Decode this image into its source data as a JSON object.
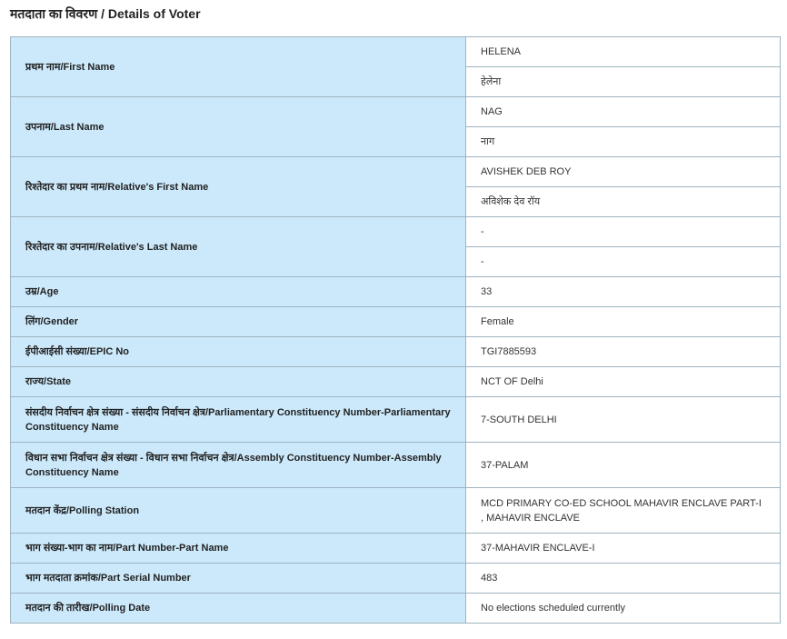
{
  "title": "मतदाता का विवरण / Details of Voter",
  "rows": [
    {
      "label": "प्रथम नाम/First Name",
      "values": [
        "HELENA",
        "हेलेना"
      ]
    },
    {
      "label": "उपनाम/Last Name",
      "values": [
        "NAG",
        "नाग"
      ]
    },
    {
      "label": "रिश्तेदार का प्रथम नाम/Relative's First Name",
      "values": [
        "AVISHEK DEB ROY",
        "अविशेक देव रॉय"
      ]
    },
    {
      "label": "रिश्तेदार का उपनाम/Relative's Last Name",
      "values": [
        "-",
        "-"
      ]
    },
    {
      "label": "उम्र/Age",
      "value": "33"
    },
    {
      "label": "लिंग/Gender",
      "value": "Female"
    },
    {
      "label": "ईपीआईसी संख्या/EPIC No",
      "value": "TGI7885593"
    },
    {
      "label": "राज्य/State",
      "value": "NCT OF Delhi"
    },
    {
      "label": "संसदीय निर्वाचन क्षेत्र संख्या - संसदीय निर्वाचन क्षेत्र/Parliamentary Constituency Number-Parliamentary Constituency Name",
      "value": "7-SOUTH DELHI"
    },
    {
      "label": "विधान सभा निर्वाचन क्षेत्र संख्या - विधान सभा निर्वाचन क्षेत्र/Assembly Constituency Number-Assembly Constituency Name",
      "value": "37-PALAM"
    },
    {
      "label": "मतदान केंद्र/Polling Station",
      "value": "MCD PRIMARY CO-ED SCHOOL MAHAVIR ENCLAVE PART-I , MAHAVIR ENCLAVE"
    },
    {
      "label": "भाग संख्या-भाग का नाम/Part Number-Part Name",
      "value": "37-MAHAVIR ENCLAVE-I"
    },
    {
      "label": "भाग मतदाता क्रमांक/Part Serial Number",
      "value": "483"
    },
    {
      "label": "मतदान की तारीख/Polling Date",
      "value": "No elections scheduled currently"
    }
  ]
}
